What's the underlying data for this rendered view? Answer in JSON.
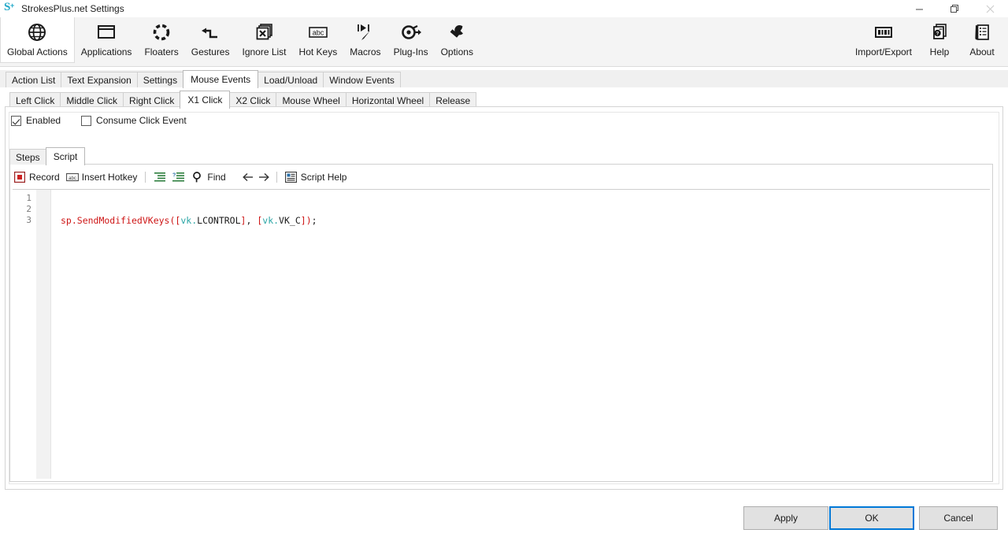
{
  "window": {
    "title": "StrokesPlus.net Settings",
    "icon": "strokesplus-logo-icon",
    "controls": {
      "minimize": "minimize-icon",
      "maximize": "restore-icon",
      "close": "close-icon"
    }
  },
  "ribbon": {
    "left_items": [
      {
        "label": "Global Actions",
        "icon": "globe-icon",
        "selected": true
      },
      {
        "label": "Applications",
        "icon": "window-icon",
        "selected": false
      },
      {
        "label": "Floaters",
        "icon": "dotted-circle-icon",
        "selected": false
      },
      {
        "label": "Gestures",
        "icon": "gesture-arrow-icon",
        "selected": false
      },
      {
        "label": "Ignore List",
        "icon": "stacked-x-icon",
        "selected": false
      },
      {
        "label": "Hot Keys",
        "icon": "abc-key-icon",
        "selected": false
      },
      {
        "label": "Macros",
        "icon": "macro-play-icon",
        "selected": false
      },
      {
        "label": "Plug-Ins",
        "icon": "plugin-gear-icon",
        "selected": false
      },
      {
        "label": "Options",
        "icon": "wrench-icon",
        "selected": false
      }
    ],
    "right_items": [
      {
        "label": "Import/Export",
        "icon": "import-export-icon"
      },
      {
        "label": "Help",
        "icon": "help-document-icon"
      },
      {
        "label": "About",
        "icon": "about-scroll-icon"
      }
    ]
  },
  "primary_tabs": {
    "items": [
      {
        "label": "Action List",
        "active": false
      },
      {
        "label": "Text Expansion",
        "active": false
      },
      {
        "label": "Settings",
        "active": false
      },
      {
        "label": "Mouse Events",
        "active": true
      },
      {
        "label": "Load/Unload",
        "active": false
      },
      {
        "label": "Window Events",
        "active": false
      }
    ]
  },
  "secondary_tabs": {
    "items": [
      {
        "label": "Left Click",
        "active": false
      },
      {
        "label": "Middle Click",
        "active": false
      },
      {
        "label": "Right Click",
        "active": false
      },
      {
        "label": "X1 Click",
        "active": true
      },
      {
        "label": "X2 Click",
        "active": false
      },
      {
        "label": "Mouse Wheel",
        "active": false
      },
      {
        "label": "Horizontal Wheel",
        "active": false
      },
      {
        "label": "Release",
        "active": false
      }
    ]
  },
  "options": {
    "enabled": {
      "label": "Enabled",
      "checked": true
    },
    "consume_click_event": {
      "label": "Consume Click Event",
      "checked": false
    }
  },
  "editor_tabs": {
    "items": [
      {
        "label": "Steps",
        "active": false
      },
      {
        "label": "Script",
        "active": true
      }
    ]
  },
  "script_toolbar": {
    "record": {
      "label": "Record",
      "icon": "record-icon"
    },
    "insert_hotkey": {
      "label": "Insert Hotkey",
      "icon": "abc-key-icon"
    },
    "indent": {
      "label": "",
      "icon": "indent-lines-icon"
    },
    "comment": {
      "label": "",
      "icon": "comment-lines-icon"
    },
    "find": {
      "label": "Find",
      "icon": "magnifier-icon"
    },
    "back": {
      "label": "",
      "icon": "arrow-left-icon"
    },
    "forward": {
      "label": "",
      "icon": "arrow-right-icon"
    },
    "script_help": {
      "label": "Script Help",
      "icon": "script-help-icon"
    }
  },
  "code_editor": {
    "line_numbers": [
      "1",
      "2",
      "3"
    ],
    "lines": [
      {
        "tokens": [
          {
            "text": "sp.SendModifiedVKeys",
            "type": "fn"
          },
          {
            "text": "(",
            "type": "br"
          },
          {
            "text": "[",
            "type": "br"
          },
          {
            "text": "vk.",
            "type": "ns"
          },
          {
            "text": "LCONTROL",
            "type": "id"
          },
          {
            "text": "]",
            "type": "br"
          },
          {
            "text": ", ",
            "type": "punct"
          },
          {
            "text": "[",
            "type": "br"
          },
          {
            "text": "vk.",
            "type": "ns"
          },
          {
            "text": "VK_C",
            "type": "id"
          },
          {
            "text": "]",
            "type": "br"
          },
          {
            "text": ")",
            "type": "br"
          },
          {
            "text": ";",
            "type": "punct"
          }
        ]
      },
      {
        "tokens": []
      },
      {
        "tokens": []
      }
    ],
    "plain_text": "sp.SendModifiedVKeys([vk.LCONTROL], [vk.VK_C]);"
  },
  "footer": {
    "apply": "Apply",
    "ok": "OK",
    "cancel": "Cancel"
  },
  "colors": {
    "accent": "#0078d7",
    "function_token": "#ce1616",
    "namespace_token": "#2aa5a5",
    "ribbon_bg": "#f4f4f4",
    "button_bg": "#e1e1e1"
  }
}
